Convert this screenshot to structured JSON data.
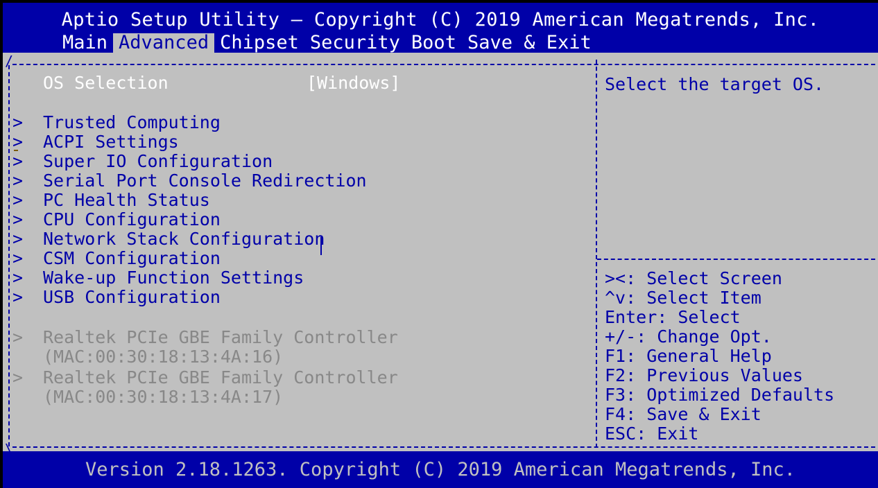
{
  "header": {
    "title": "Aptio Setup Utility – Copyright (C) 2019 American Megatrends, Inc.",
    "tabs": [
      {
        "label": "Main",
        "active": false
      },
      {
        "label": "Advanced",
        "active": true
      },
      {
        "label": "Chipset",
        "active": false
      },
      {
        "label": "Security",
        "active": false
      },
      {
        "label": "Boot",
        "active": false
      },
      {
        "label": "Save & Exit",
        "active": false
      }
    ]
  },
  "settings": {
    "os_selection": {
      "label": "OS Selection",
      "value": "[Windows]"
    }
  },
  "menu": {
    "items": [
      "Trusted Computing",
      "ACPI Settings",
      "Super IO Configuration",
      "Serial Port Console Redirection",
      "PC Health Status",
      "CPU Configuration",
      "Network Stack Configuration",
      "CSM Configuration",
      "Wake-up Function Settings",
      "USB Configuration"
    ],
    "nic_items": [
      {
        "name": "Realtek PCIe GBE Family Controller",
        "mac": "(MAC:00:30:18:13:4A:16)"
      },
      {
        "name": "Realtek PCIe GBE Family Controller",
        "mac": "(MAC:00:30:18:13:4A:17)"
      }
    ],
    "submenu_marker": ">"
  },
  "help": {
    "description": "Select the target OS.",
    "keys": [
      "><: Select Screen",
      "^v: Select Item",
      "Enter: Select",
      "+/-: Change Opt.",
      "F1: General Help",
      "F2: Previous Values",
      "F3: Optimized Defaults",
      "F4: Save & Exit",
      "ESC: Exit"
    ]
  },
  "footer": {
    "version": "Version 2.18.1263. Copyright (C) 2019 American Megatrends, Inc."
  },
  "colors": {
    "header_bg": "#0000a8",
    "body_bg": "#c0c0c0",
    "text_blue": "#0000a8",
    "highlight_white": "#ffffff",
    "disabled_gray": "#888888"
  }
}
